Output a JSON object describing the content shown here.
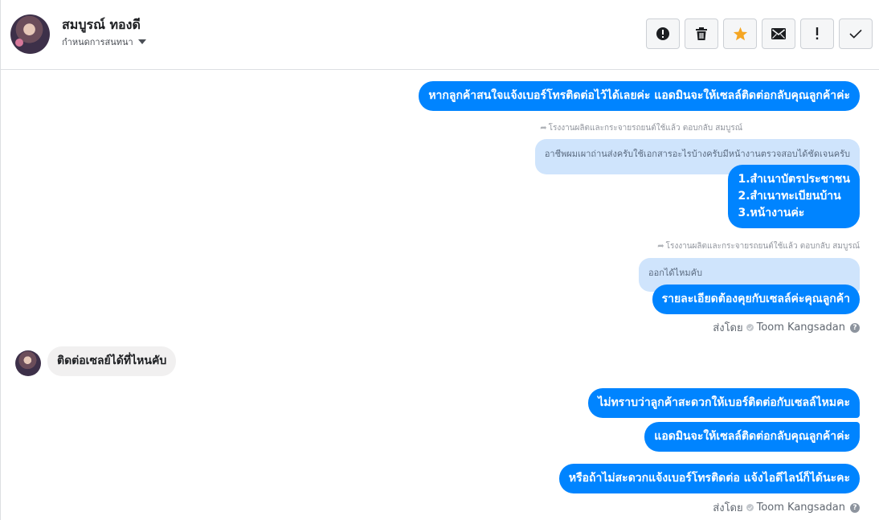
{
  "contact": {
    "name": "สมบูรณ์ ทองดี",
    "subtitle": "กำหนดการสนทนา"
  },
  "toolbar": {
    "icons": [
      "alert-circle-icon",
      "trash-icon",
      "star-icon",
      "mail-icon",
      "exclamation-icon",
      "check-icon"
    ],
    "star_color": "#f5a623"
  },
  "colors": {
    "outgoing": "#0084ff",
    "incoming": "#f1f0f0",
    "quoted": "#cfe4fc"
  },
  "messages": {
    "m1": "หากลูกค้าสนใจแจ้งเบอร์โทรติดต่อไว้ได้เลยค่ะ แอดมินจะให้เซลล์ติดต่อกลับคุณลูกค้าค่ะ",
    "reply1_meta": "โรงงานผลิตและกระจายรถยนต์ใช้แล้ว ตอบกลับ สมบูรณ์",
    "reply1_quote": "อาชีพผมเผาถ่านส่งครับใช้เอกสารอะไรบ้างครับมีหน้างานตรวจสอบได้ชัดเจนครับ",
    "m2_lines": [
      "1.สำเนาบัตรประชาชน",
      "2.สำเนาทะเบียนบ้าน",
      "3.หน้างานค่ะ"
    ],
    "reply2_meta": "โรงงานผลิตและกระจายรถยนต์ใช้แล้ว ตอบกลับ สมบูรณ์",
    "reply2_quote": "ออกได้ไหมคับ",
    "m3": "รายละเอียดต้องคุยกับเซลล์ค่ะคุณลูกค้า",
    "sent_by_1": "ส่งโดย",
    "agent_1": "Toom Kangsadan",
    "incoming1": "ติดต่อเซลย์ได้ที่ไหนคับ",
    "m4": "ไม่ทราบว่าลูกค้าสะดวกให้เบอร์ติดต่อกับเซลล์ไหมคะ",
    "m5": "แอดมินจะให้เซลล์ติดต่อกลับคุณลูกค้าค่ะ",
    "m6": "หรือถ้าไม่สะดวกแจ้งเบอร์โทรติดต่อ แจ้งไอดีไลน์ก็ได้นะคะ",
    "sent_by_2": "ส่งโดย",
    "agent_2": "Toom Kangsadan"
  }
}
